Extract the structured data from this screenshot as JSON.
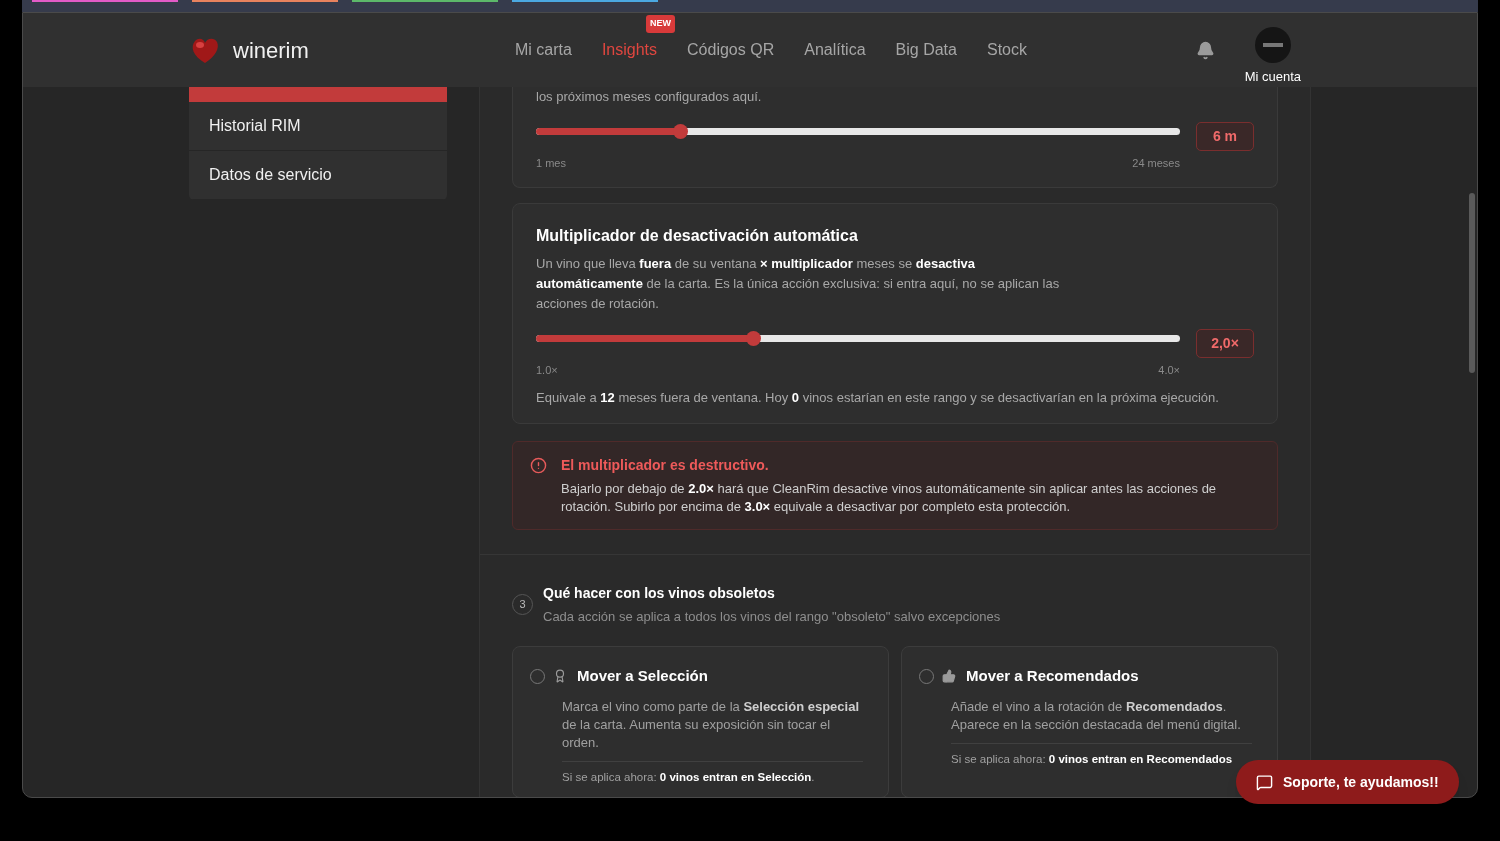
{
  "browser_tabs": [
    {
      "color": "#e25bc8"
    },
    {
      "color": "#e8825e"
    },
    {
      "color": "#5cb86a"
    },
    {
      "color": "#4ba8e2"
    }
  ],
  "header": {
    "brand": "winerim",
    "nav": [
      {
        "label": "Mi carta",
        "selected": false
      },
      {
        "label": "Insights",
        "selected": true,
        "badge": "NEW"
      },
      {
        "label": "Códigos QR",
        "selected": false
      },
      {
        "label": "Analítica",
        "selected": false
      },
      {
        "label": "Big Data",
        "selected": false
      },
      {
        "label": "Stock",
        "selected": false
      }
    ],
    "account": "Mi cuenta"
  },
  "sidebar": {
    "items": [
      {
        "label": "Historial RIM",
        "selected": false
      },
      {
        "label": "Datos de servicio",
        "selected": false
      }
    ]
  },
  "settings": [
    {
      "description": "los próximos meses configurados aquí.",
      "level": 0.224,
      "value": "6 m",
      "min_label": "1 mes",
      "max_label": "24 meses"
    },
    {
      "title": "Multiplicador de desactivación automática",
      "description": "Un vino que lleva **fuera** de su ventana **× multiplicador** meses se **desactiva automáticamente** de la carta. Es la única acción exclusiva: si entra aquí, no se aplican las acciones de rotación.",
      "level": 0.337,
      "value": "2,0×",
      "min_label": "1.0×",
      "max_label": "4.0×",
      "note": "Equivale a **12** meses fuera de ventana. Hoy **0** vinos estarían en este rango y se desactivarían en la próxima ejecución."
    }
  ],
  "warning": {
    "title": "El multiplicador es destructivo.",
    "text": "Bajarlo por debajo de **2.0×** hará que CleanRim desactive vinos automáticamente sin aplicar antes las acciones de rotación. Subirlo por encima de **3.0×** equivale a desactivar por completo esta protección."
  },
  "section": {
    "number": "3",
    "title": "Qué hacer con los vinos obsoletos",
    "subtitle": "Cada acción se aplica a todos los vinos del rango \"obsoleto\" salvo excepciones",
    "options": [
      {
        "kind": "award",
        "title": "Mover a Selección",
        "selected": false,
        "description": "Marca el vino como parte de la **Selección especial** de la carta. Aumenta su exposición sin tocar el orden.",
        "footer": "Si se aplica ahora: **0 vinos entran en Selección**."
      },
      {
        "kind": "thumbs",
        "title": "Mover a Recomendados",
        "selected": false,
        "description": "Añade el vino a la rotación de **Recomendados**. Aparece en la sección destacada del menú digital.",
        "footer": "Si se aplica ahora: **0 vinos entran en Recomendados**"
      }
    ]
  },
  "support_button": "Soporte, te ayudamos!!"
}
